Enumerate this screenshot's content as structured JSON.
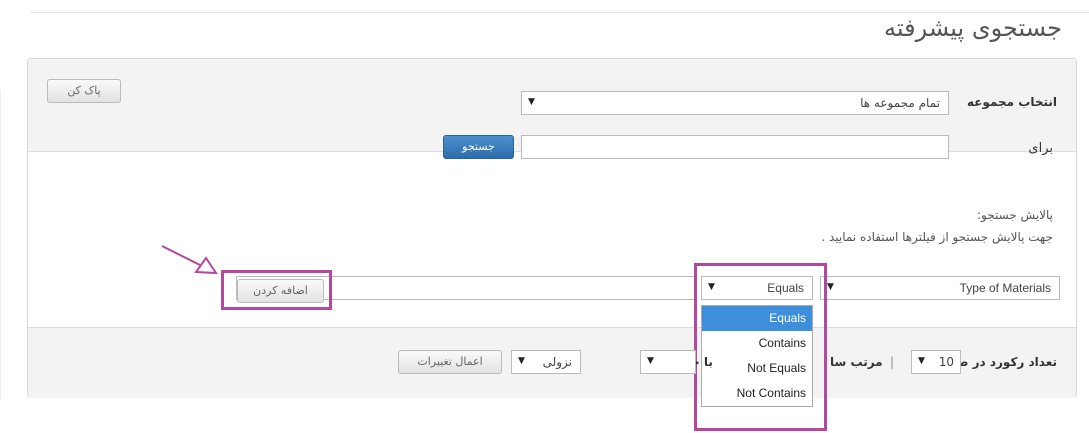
{
  "page": {
    "title": "جستجوی پیشرفته"
  },
  "header_form": {
    "collection_label": "انتخاب مجموعه",
    "collection_value": "تمام مجموعه ها",
    "for_label": "برای",
    "search_input_value": "",
    "search_button": "جستجو",
    "clear_button": "پاک کن"
  },
  "filters": {
    "heading": "پالایش جستجو:",
    "hint": "جهت پالایش جستجو از فیلترها استفاده نمایید .",
    "field_value": "Type of Materials",
    "operator_value": "Equals",
    "text_value": "",
    "add_button": "اضافه کردن",
    "operator_options": [
      "Equals",
      "Contains",
      "Not Equals",
      "Not Contains"
    ],
    "selected_option": "Equals"
  },
  "footer": {
    "records_label": "تعداد رکورد در صفحه",
    "records_value": "10",
    "separator": "|",
    "sort_label": "مرتب سا",
    "order_label": "با چیدمان",
    "order_value": "نزولی",
    "apply_button": "اعمال تغییرات"
  },
  "colors": {
    "highlight": "#b5479e",
    "primary": "#2d6ea9",
    "selected": "#3d8fdc"
  }
}
